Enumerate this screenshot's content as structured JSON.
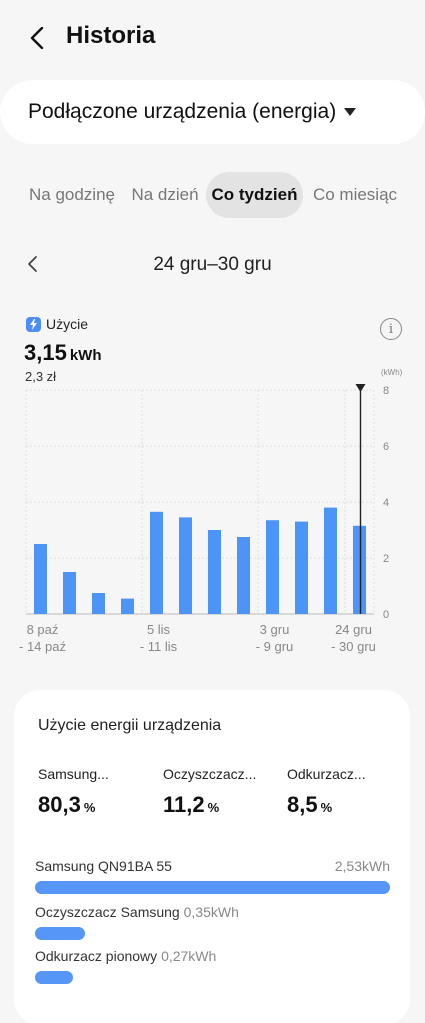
{
  "header": {
    "title": "Historia",
    "back_icon": "chevron-left-icon"
  },
  "selector": {
    "label": "Podłączone urządzenia (energia)"
  },
  "tabs": [
    {
      "label": "Na godzinę",
      "active": false
    },
    {
      "label": "Na dzień",
      "active": false
    },
    {
      "label": "Co tydzień",
      "active": true
    },
    {
      "label": "Co miesiąc",
      "active": false
    }
  ],
  "period": {
    "label": "24 gru–30 gru"
  },
  "usage": {
    "label": "Użycie",
    "value": "3,15",
    "unit": "kWh",
    "cost": "2,3 zł"
  },
  "chart_data": {
    "type": "bar",
    "unit_label": "(kWh)",
    "ylim": [
      0,
      8
    ],
    "y_ticks": [
      "0",
      "2",
      "4",
      "6",
      "8"
    ],
    "grid": true,
    "values": [
      2.5,
      1.5,
      0.75,
      0.55,
      3.65,
      3.45,
      3.0,
      2.75,
      3.35,
      3.3,
      3.8,
      3.15
    ],
    "selected_index": 11,
    "x_labels": [
      {
        "line1": "8 paź",
        "line2": "- 14 paź",
        "index": 0
      },
      {
        "line1": "5 lis",
        "line2": "- 11 lis",
        "index": 4
      },
      {
        "line1": "3 gru",
        "line2": "- 9 gru",
        "index": 8
      },
      {
        "line1": "24 gru",
        "line2": "- 30 gru",
        "index": 11
      }
    ],
    "bar_color": "#4c94f6"
  },
  "device_usage": {
    "title": "Użycie energii urządzenia",
    "shares": [
      {
        "name": "Samsung...",
        "value": "80,3",
        "unit": "%"
      },
      {
        "name": "Oczyszczacz...",
        "value": "11,2",
        "unit": "%"
      },
      {
        "name": "Odkurzacz...",
        "value": "8,5",
        "unit": "%"
      }
    ],
    "devices": [
      {
        "name": "Samsung QN91BA 55",
        "kwh": "2,53kWh",
        "fraction": 1.0
      },
      {
        "name": "Oczyszczacz Samsung",
        "kwh": "0,35kWh",
        "fraction": 0.14
      },
      {
        "name": "Odkurzacz pionowy",
        "kwh": "0,27kWh",
        "fraction": 0.107
      }
    ]
  }
}
